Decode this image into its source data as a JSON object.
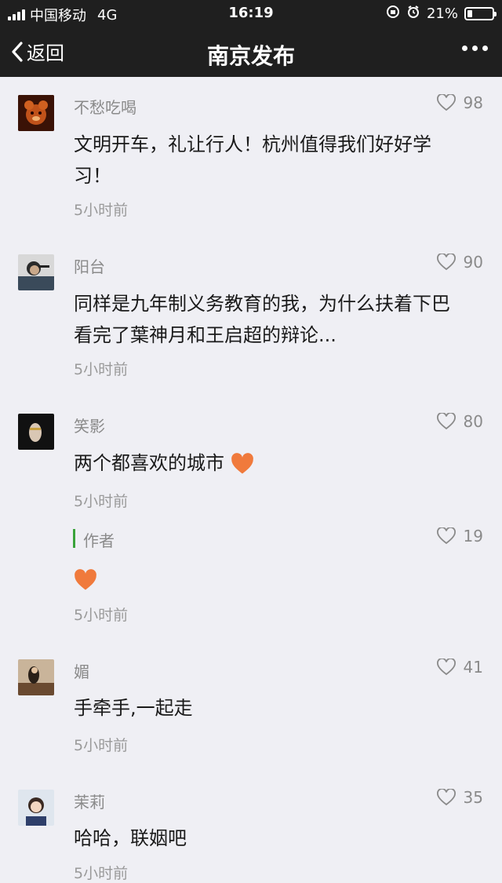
{
  "status_bar": {
    "carrier": "中国移动",
    "network": "4G",
    "time": "16:19",
    "battery_percent_text": "21%",
    "battery_level": 0.21
  },
  "nav": {
    "back_label": "返回",
    "title": "南京发布"
  },
  "comments": [
    {
      "name": "不愁吃喝",
      "likes": "98",
      "text_line1": "文明开车，礼让行人！杭州值得我们好好学",
      "text_line2": "习！",
      "time": "5小时前"
    },
    {
      "name": "阳台",
      "likes": "90",
      "text_line1": "同样是九年制义务教育的我，为什么扶着下巴",
      "text_line2": "看完了葉神月和王启超的辩论...",
      "time": "5小时前"
    },
    {
      "name": "笑影",
      "likes": "80",
      "text_line1": "两个都喜欢的城市",
      "time": "5小时前",
      "reply": {
        "label": "作者",
        "likes": "19",
        "time": "5小时前"
      }
    },
    {
      "name": "媚",
      "likes": "41",
      "text_line1": "手牵手,一起走",
      "time": "5小时前"
    },
    {
      "name": "茉莉",
      "likes": "35",
      "text_line1": "哈哈，联姻吧",
      "time": "5小时前"
    }
  ],
  "colors": {
    "bar_bg": "#1f1f1f",
    "page_bg": "#efeff4",
    "author_accent": "#3aa33a",
    "heart_emoji": "#f07a3c"
  }
}
